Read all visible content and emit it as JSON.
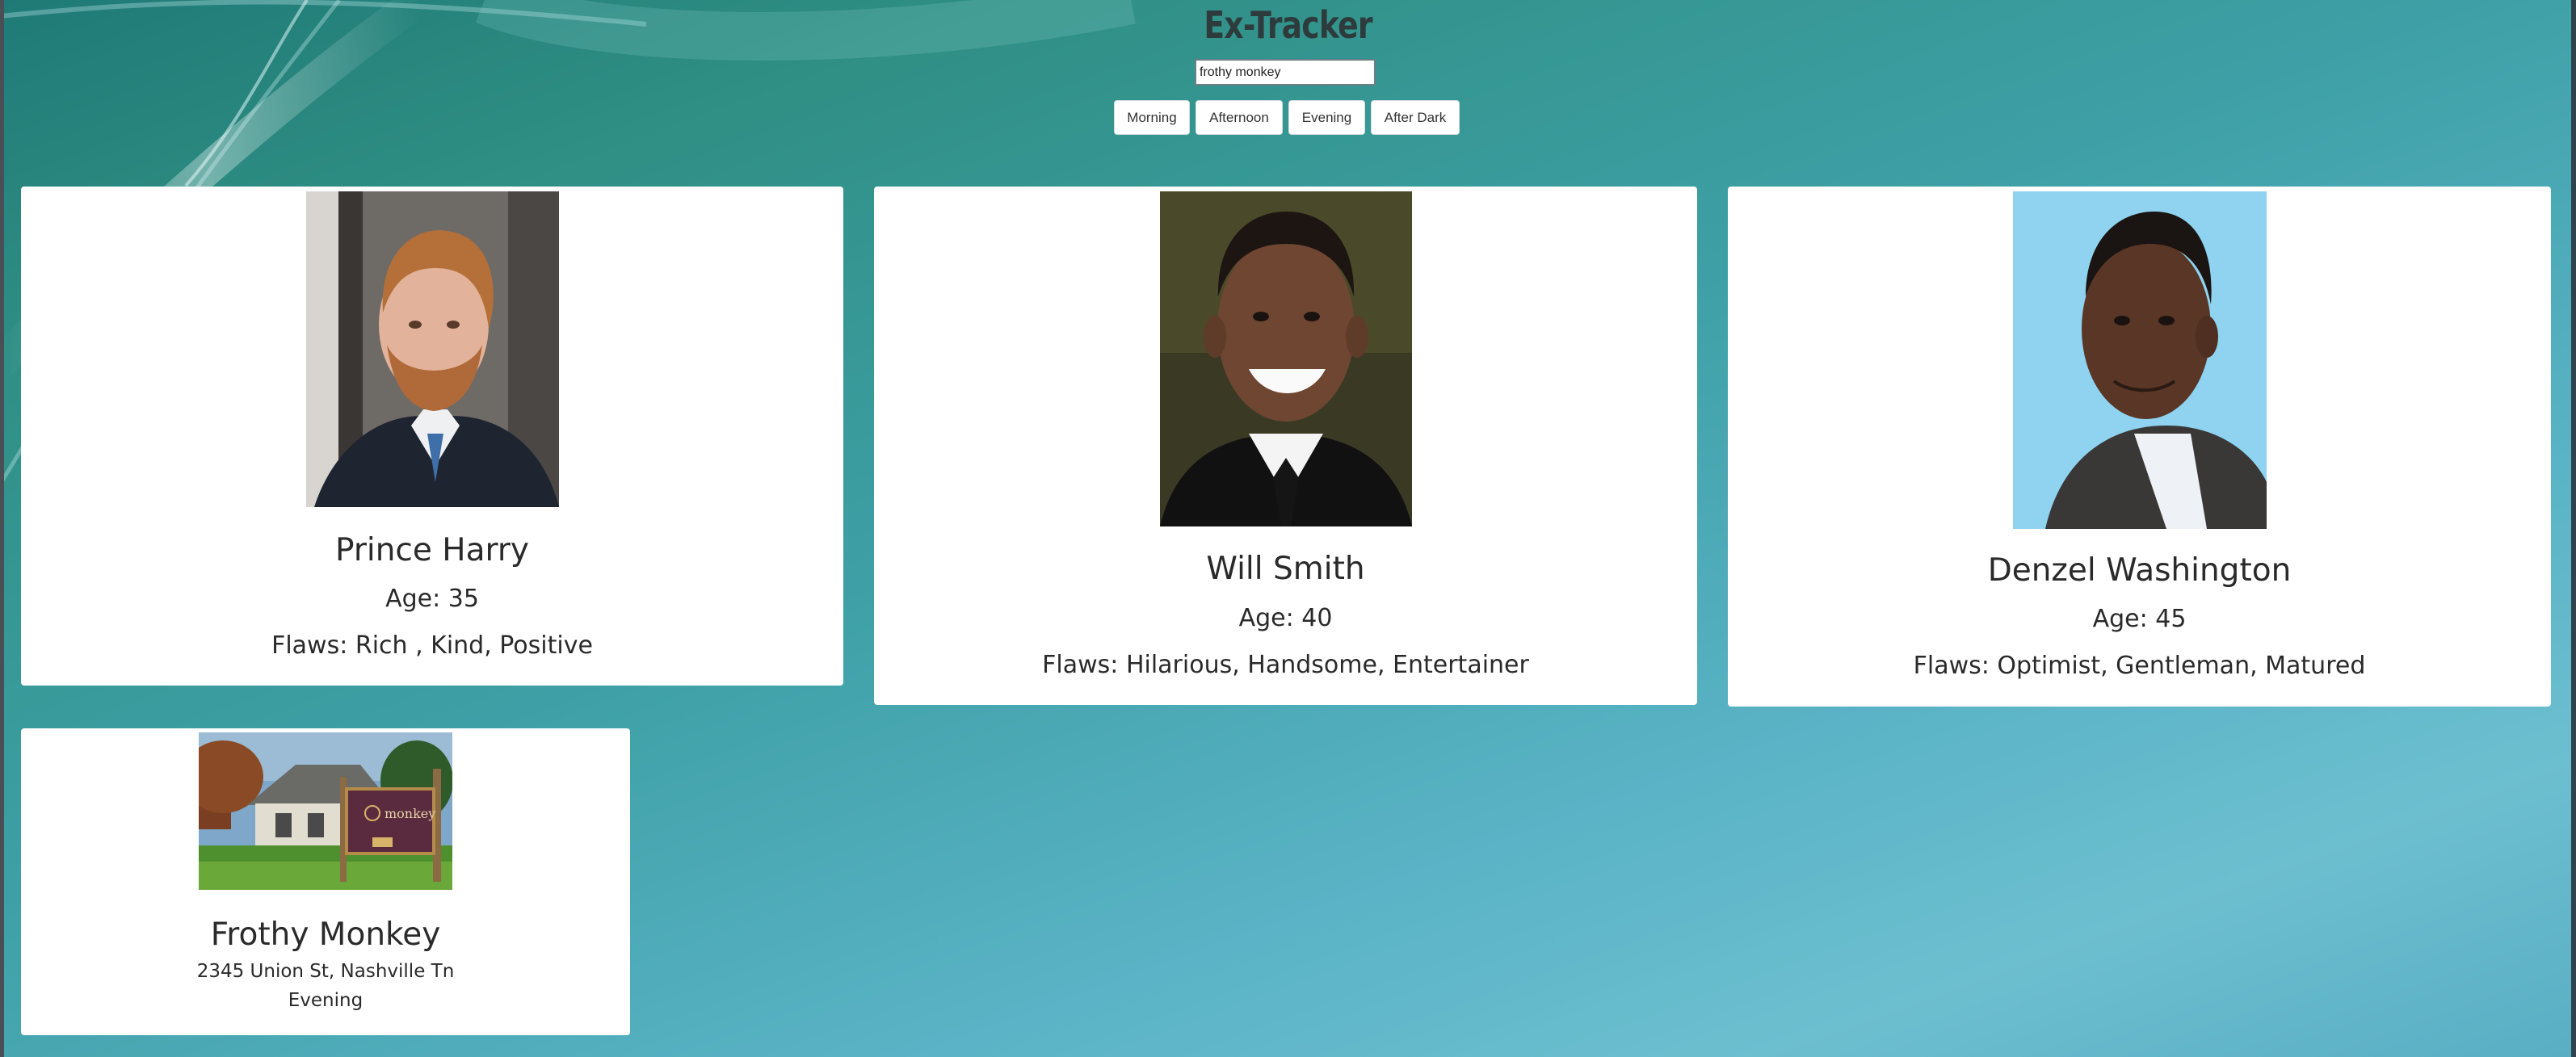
{
  "app": {
    "title": "Ex-Tracker"
  },
  "search": {
    "value": "frothy monkey"
  },
  "filters": [
    {
      "label": "Morning"
    },
    {
      "label": "Afternoon"
    },
    {
      "label": "Evening"
    },
    {
      "label": "After Dark"
    }
  ],
  "exes": [
    {
      "name": "Prince Harry",
      "age": "Age: 35",
      "flaws": "Flaws: Rich , Kind, Positive"
    },
    {
      "name": "Will Smith",
      "age": "Age: 40",
      "flaws": "Flaws: Hilarious, Handsome, Entertainer"
    },
    {
      "name": "Denzel Washington",
      "age": "Age: 45",
      "flaws": "Flaws: Optimist, Gentleman, Matured"
    }
  ],
  "places": [
    {
      "name": "Frothy Monkey",
      "address": "2345 Union St, Nashville Tn",
      "time": "Evening",
      "sign_text": "monkey"
    }
  ],
  "colors": {
    "background_top": "#1f7a76",
    "background_bottom": "#6cbfcf",
    "card": "#ffffff",
    "text": "#2a2a2a"
  }
}
